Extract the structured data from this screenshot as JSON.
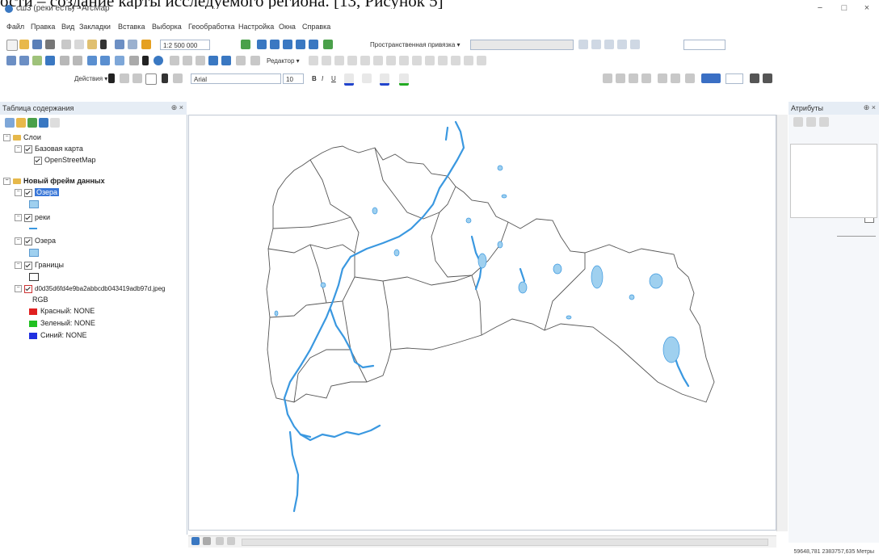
{
  "caption": "ости – создание карты исследуемого региона. [13, Рисунок 5]",
  "window": {
    "title": "сш3 (реки есть) - ArcMap",
    "minimize": "−",
    "maximize": "□",
    "close": "×"
  },
  "menu": [
    "Файл",
    "Правка",
    "Вид",
    "Закладки",
    "Вставка",
    "Выборка",
    "Геообработка",
    "Настройка",
    "Окна",
    "Справка"
  ],
  "toolbar": {
    "scale": "1:2 500 000",
    "spatial_adjust_label": "Пространственная привязка ▾",
    "editor_label": "Редактор ▾",
    "actions_label": "Действия ▾",
    "font_name": "Arial",
    "font_size": "10",
    "bold": "B",
    "italic": "I",
    "underline": "U"
  },
  "toc": {
    "title": "Таблица содержания",
    "pin": "⊕ ×",
    "groups": [
      {
        "label": "Слои",
        "bold": false
      },
      {
        "label": "Базовая карта"
      },
      {
        "label": "OpenStreetMap"
      },
      {
        "label": "Новый фрейм данных",
        "bold": true
      },
      {
        "label": "Озера"
      },
      {
        "label": "реки"
      },
      {
        "label": "Озера"
      },
      {
        "label": "Границы"
      },
      {
        "label": "d0d35d6fd4e9ba2abbcdb043419adb97d.jpeg"
      },
      {
        "label": "RGB"
      }
    ],
    "bands": [
      {
        "label": "Красный: NONE",
        "color": "#e02020"
      },
      {
        "label": "Зеленый: NONE",
        "color": "#20c020"
      },
      {
        "label": "Синий: NONE",
        "color": "#2030e0"
      }
    ]
  },
  "attributes": {
    "title": "Атрибуты",
    "pin": "⊕ ×"
  },
  "status": {
    "coordinates": "59648,781 2383757,635 Метры"
  },
  "colors": {
    "water": "#9fd0ef",
    "river": "#3a98e0",
    "boundary": "#555555",
    "selection": "#3b78d8"
  }
}
